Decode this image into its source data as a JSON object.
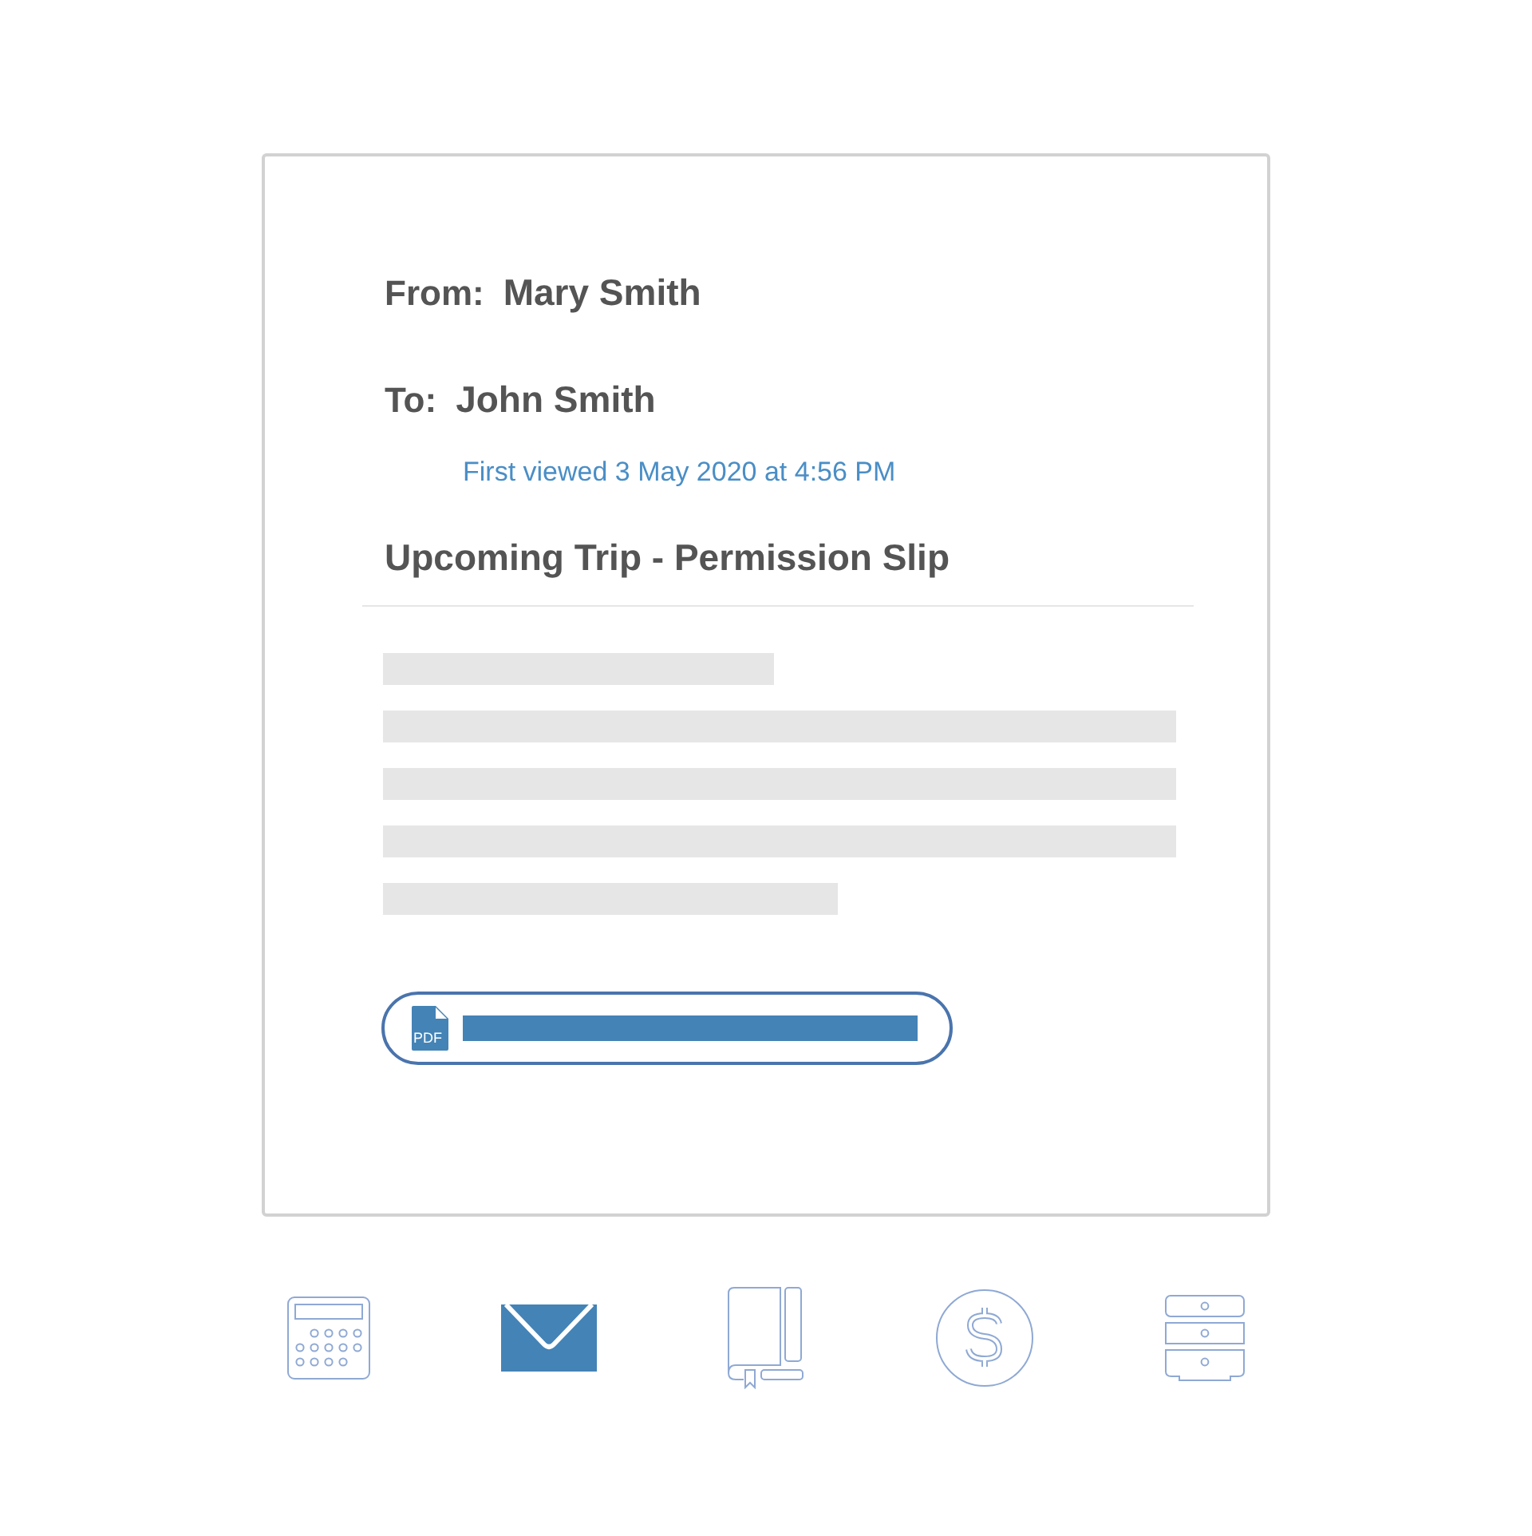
{
  "message": {
    "from_label": "From:",
    "from_name": "Mary Smith",
    "to_label": "To:",
    "to_name": "John Smith",
    "first_viewed": "First viewed 3 May 2020 at 4:56 PM",
    "subject": "Upcoming Trip - Permission Slip",
    "attachment": {
      "file_type": "PDF"
    }
  },
  "nav": [
    {
      "kind": "calculator",
      "selected": false
    },
    {
      "kind": "mail",
      "selected": true
    },
    {
      "kind": "book",
      "selected": false
    },
    {
      "kind": "dollar",
      "selected": false
    },
    {
      "kind": "cabinet",
      "selected": false
    }
  ]
}
